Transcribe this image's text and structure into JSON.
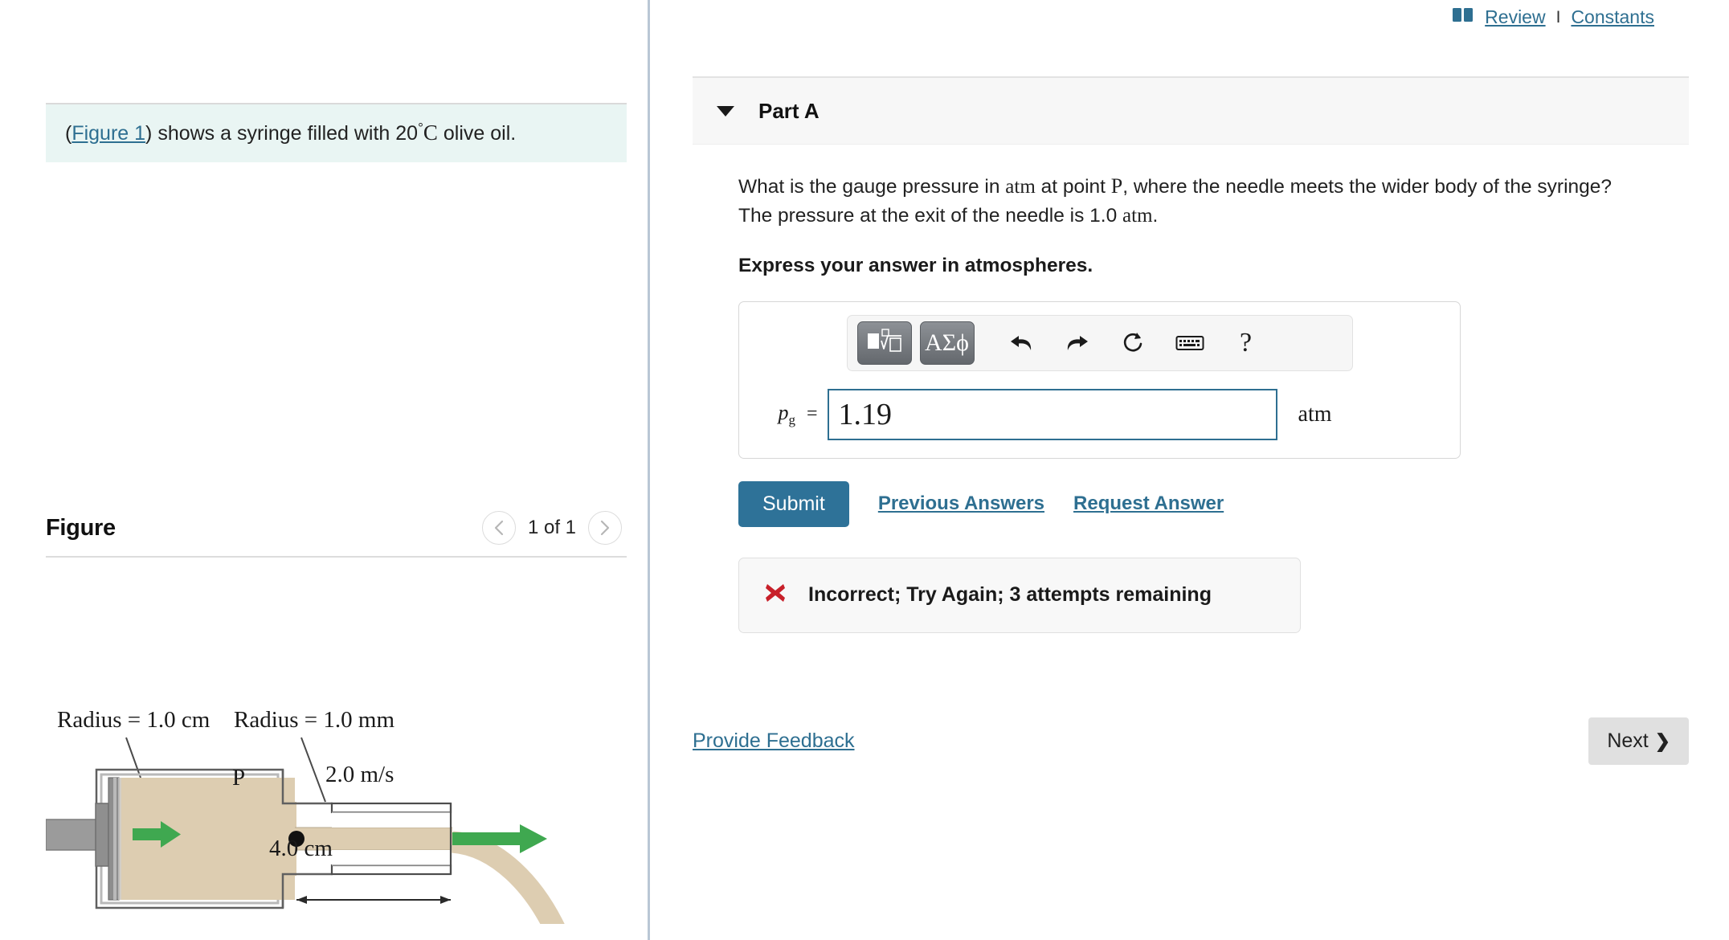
{
  "top_links": {
    "book_icon": "book-icon",
    "review_label": "Review",
    "separator": "I",
    "constants_label": "Constants"
  },
  "left_pane": {
    "intro": {
      "figure_link": "Figure 1",
      "before": "(",
      "after_link": ") shows a syringe filled with 20",
      "degree": "°",
      "celsius": "C",
      "tail": " olive oil."
    },
    "figure_section": {
      "title": "Figure",
      "prev_icon": "chevron-left-icon",
      "next_icon": "chevron-right-icon",
      "pager_label": "1 of 1"
    },
    "diagram": {
      "label_radius_body": "Radius = 1.0 cm",
      "label_radius_needle": "Radius = 1.0 mm",
      "label_speed": "2.0 m/s",
      "label_length": "4.0 cm",
      "label_point": "P",
      "colors": {
        "oil": "#ddcdb1",
        "oil_dark": "#d4c2a2",
        "arrow_green": "#3fa850",
        "plunger_gray": "#9a9a9a",
        "outline": "#555555"
      }
    }
  },
  "right_pane": {
    "part": {
      "caret_icon": "caret-down-icon",
      "title": "Part A"
    },
    "question": {
      "line1_a": "What is the gauge pressure in ",
      "unit_atm": "atm",
      "line1_b": " at point ",
      "point": "P",
      "line1_c": ", where the needle meets the wider body of the syringe? The pressure at the exit of the needle is 1.0 ",
      "unit_atm2": "atm",
      "line1_d": ".",
      "instruction": "Express your answer in atmospheres."
    },
    "math_toolbar": {
      "template_button_icon": "math-template-icon",
      "symbols_button_label": "ΑΣϕ",
      "undo_icon": "undo-icon",
      "redo_icon": "redo-icon",
      "reset_icon": "refresh-icon",
      "keyboard_icon": "keyboard-icon",
      "help_label": "?"
    },
    "answer": {
      "variable": "p",
      "subscript": "g",
      "equals": "=",
      "value": "1.19",
      "placeholder": "",
      "unit": "atm"
    },
    "actions": {
      "submit_label": "Submit",
      "previous_answers_label": "Previous Answers",
      "request_answer_label": "Request Answer"
    },
    "feedback": {
      "icon": "x-mark-icon",
      "message": "Incorrect; Try Again; 3 attempts remaining"
    },
    "bottom": {
      "provide_feedback_label": "Provide Feedback",
      "next_label": "Next",
      "next_chevron": "❯"
    }
  }
}
